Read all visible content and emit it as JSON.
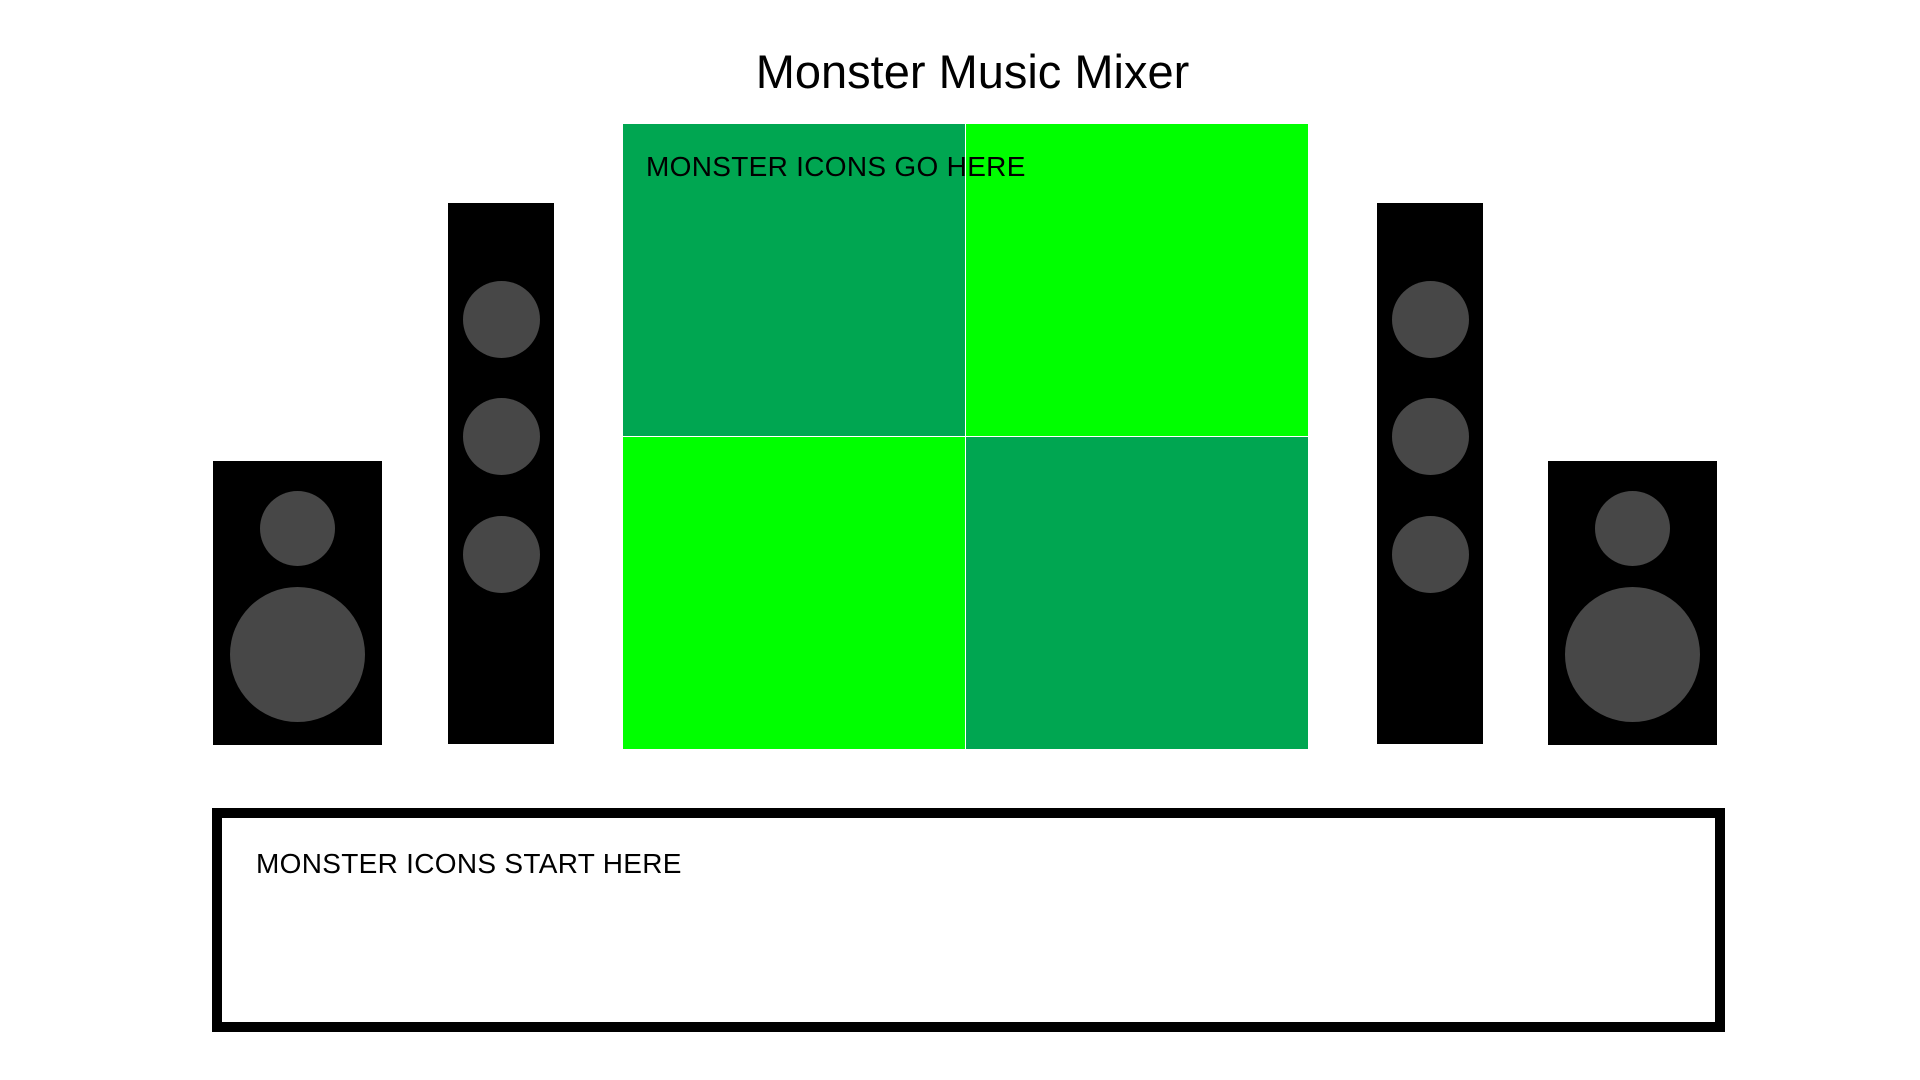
{
  "app": {
    "title": "Monster Music Mixer"
  },
  "drop_zone": {
    "label": "MONSTER ICONS GO HERE",
    "cells": [
      {
        "id": "top-left",
        "color": "#00a651"
      },
      {
        "id": "top-right",
        "color": "#00ff00"
      },
      {
        "id": "bottom-left",
        "color": "#00ff00"
      },
      {
        "id": "bottom-right",
        "color": "#00a651"
      }
    ]
  },
  "start_tray": {
    "label": "MONSTER ICONS START HERE"
  },
  "colors": {
    "speaker_body": "#000000",
    "speaker_driver": "#474747",
    "dark_green": "#00a651",
    "bright_green": "#00ff00",
    "tray_border": "#000000"
  }
}
